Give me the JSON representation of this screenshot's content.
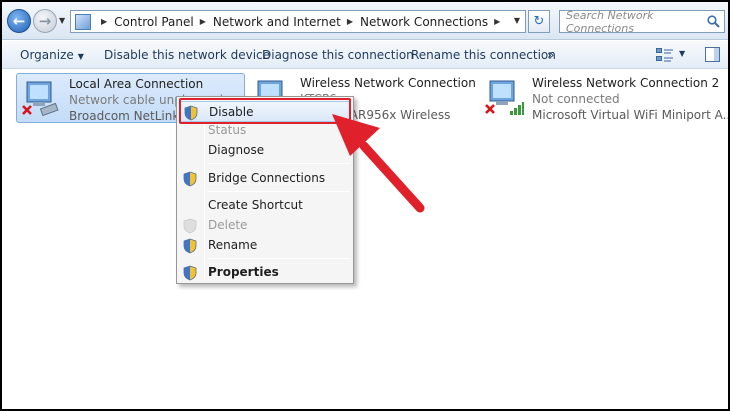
{
  "address": {
    "breadcrumbs": [
      "Control Panel",
      "Network and Internet",
      "Network Connections"
    ],
    "search_placeholder": "Search Network Connections"
  },
  "toolbar": {
    "organize": "Organize",
    "disable_device": "Disable this network device",
    "diagnose": "Diagnose this connection",
    "rename": "Rename this connection",
    "more": "»"
  },
  "connections": [
    {
      "name": "Local Area Connection",
      "status": "Network cable unplugged",
      "device": "Broadcom NetLink (TM)",
      "icon": "wired-adapter-icon",
      "state": "disconnected"
    },
    {
      "name": "Wireless Network Connection",
      "status": "KTCP6",
      "device": "Atheros AR956x Wireless",
      "icon": "wireless-adapter-icon",
      "state": "connected"
    },
    {
      "name": "Wireless Network Connection 2",
      "status": "Not connected",
      "device": "Microsoft Virtual WiFi Miniport A...",
      "icon": "wireless-adapter-icon",
      "state": "disconnected"
    }
  ],
  "context_menu": {
    "items": [
      {
        "label": "Disable",
        "icon": "shield-icon",
        "state": "highlighted"
      },
      {
        "label": "Status",
        "icon": "",
        "state": "disabled"
      },
      {
        "label": "Diagnose",
        "icon": "",
        "state": "normal"
      },
      {
        "label": "Bridge Connections",
        "icon": "shield-icon",
        "state": "normal"
      },
      {
        "label": "Create Shortcut",
        "icon": "",
        "state": "normal"
      },
      {
        "label": "Delete",
        "icon": "shield-icon",
        "state": "disabled"
      },
      {
        "label": "Rename",
        "icon": "shield-icon",
        "state": "normal"
      },
      {
        "label": "Properties",
        "icon": "shield-icon",
        "state": "default"
      }
    ]
  },
  "colors": {
    "annotation": "#e0202a",
    "selection": "#c3dcf7",
    "toolbar_text": "#1e395b"
  }
}
